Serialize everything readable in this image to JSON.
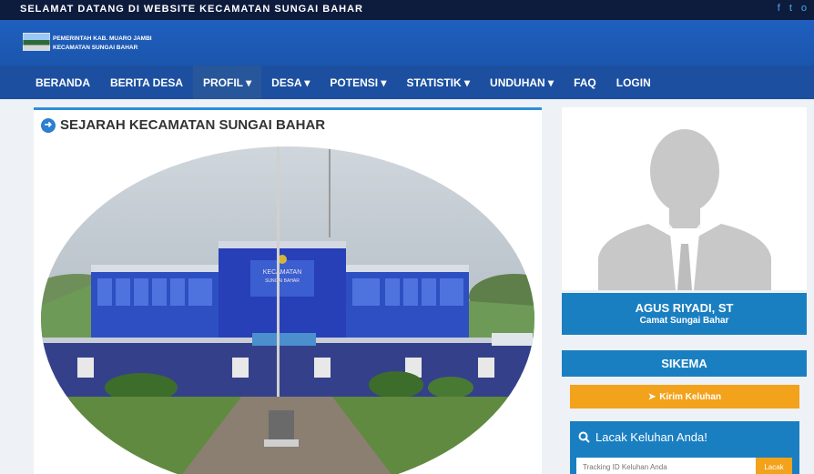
{
  "topbar": {
    "marquee": "SELAMAT DATANG DI WEBSITE KECAMATAN SUNGAI BAHAR",
    "social": [
      "f",
      "t",
      "o"
    ]
  },
  "header": {
    "line1": "PEMERINTAH KAB. MUARO JAMBI",
    "line2": "KECAMATAN SUNGAI BAHAR"
  },
  "nav": {
    "items": [
      {
        "label": "BERANDA"
      },
      {
        "label": "BERITA DESA"
      },
      {
        "label": "PROFIL ▾"
      },
      {
        "label": "DESA ▾"
      },
      {
        "label": "POTENSI ▾"
      },
      {
        "label": "STATISTIK ▾"
      },
      {
        "label": "UNDUHAN ▾"
      },
      {
        "label": "FAQ"
      },
      {
        "label": "LOGIN"
      }
    ],
    "active_index": 2
  },
  "main": {
    "title": "SEJARAH KECAMATAN SUNGAI BAHAR",
    "building_sign": "KECAMATAN SUNGAI BAHAR"
  },
  "profile": {
    "name": "AGUS RIYADI, ST",
    "role": "Camat Sungai Bahar"
  },
  "sikema": {
    "title": "SIKEMA",
    "kirim_label": "Kirim Keluhan",
    "lacak_title": "Lacak Keluhan Anda!",
    "input_placeholder": "Tracking ID Keluhan Anda",
    "lacak_button": "Lacak"
  },
  "colors": {
    "topbar": "#0d1b3d",
    "header": "#1f5fbf",
    "nav": "#1c4fa0",
    "accent_blue": "#1a7fc1",
    "accent_orange": "#f3a21b"
  }
}
